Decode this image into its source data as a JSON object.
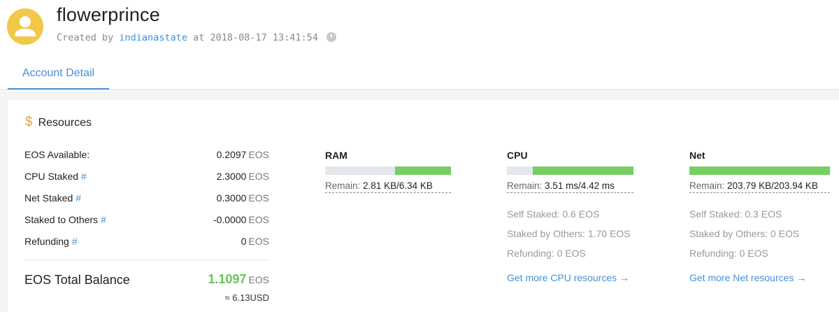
{
  "account": {
    "name": "flowerprince",
    "created_by_prefix": "Created by",
    "creator": "indianastate",
    "created_at_prefix": "at",
    "created_at": "2018-08-17 13:41:54"
  },
  "tabs": [
    {
      "label": "Account Detail",
      "active": true
    }
  ],
  "resources": {
    "heading": "Resources",
    "rows": [
      {
        "label": "EOS Available:",
        "hash": "",
        "value": "0.2097",
        "unit": "EOS"
      },
      {
        "label": "CPU Staked",
        "hash": "#",
        "value": "2.3000",
        "unit": "EOS"
      },
      {
        "label": "Net Staked",
        "hash": "#",
        "value": "0.3000",
        "unit": "EOS"
      },
      {
        "label": "Staked to Others",
        "hash": "#",
        "value": "-0.0000",
        "unit": "EOS"
      },
      {
        "label": "Refunding",
        "hash": "#",
        "value": "0",
        "unit": "EOS"
      }
    ],
    "total": {
      "label": "EOS Total Balance",
      "value": "1.1097",
      "unit": "EOS",
      "usd_prefix": "≈",
      "usd_value": "6.13",
      "usd_unit": "USD"
    }
  },
  "ram": {
    "title": "RAM",
    "remain_label": "Remain:",
    "remain_value": "2.81 KB/6.34 KB",
    "used_fraction": 0.443
  },
  "cpu": {
    "title": "CPU",
    "remain_label": "Remain:",
    "remain_value": "3.51 ms/4.42 ms",
    "used_fraction": 0.794,
    "self_staked": "Self Staked: 0.6 EOS",
    "staked_by_others": "Staked by Others: 1.70 EOS",
    "refunding": "Refunding: 0 EOS",
    "more_link": "Get more CPU resources →"
  },
  "net": {
    "title": "Net",
    "remain_label": "Remain:",
    "remain_value": "203.79 KB/203.94 KB",
    "used_fraction": 0.999,
    "self_staked": "Self Staked: 0.3 EOS",
    "staked_by_others": "Staked by Others: 0 EOS",
    "refunding": "Refunding: 0 EOS",
    "more_link": "Get more Net resources →"
  },
  "colors": {
    "accent": "#4a8fd3",
    "bar_fill": "#78cd65",
    "bar_track": "#e3e7ec",
    "total_value": "#6cc35b",
    "avatar_bg": "#f0c94a"
  }
}
